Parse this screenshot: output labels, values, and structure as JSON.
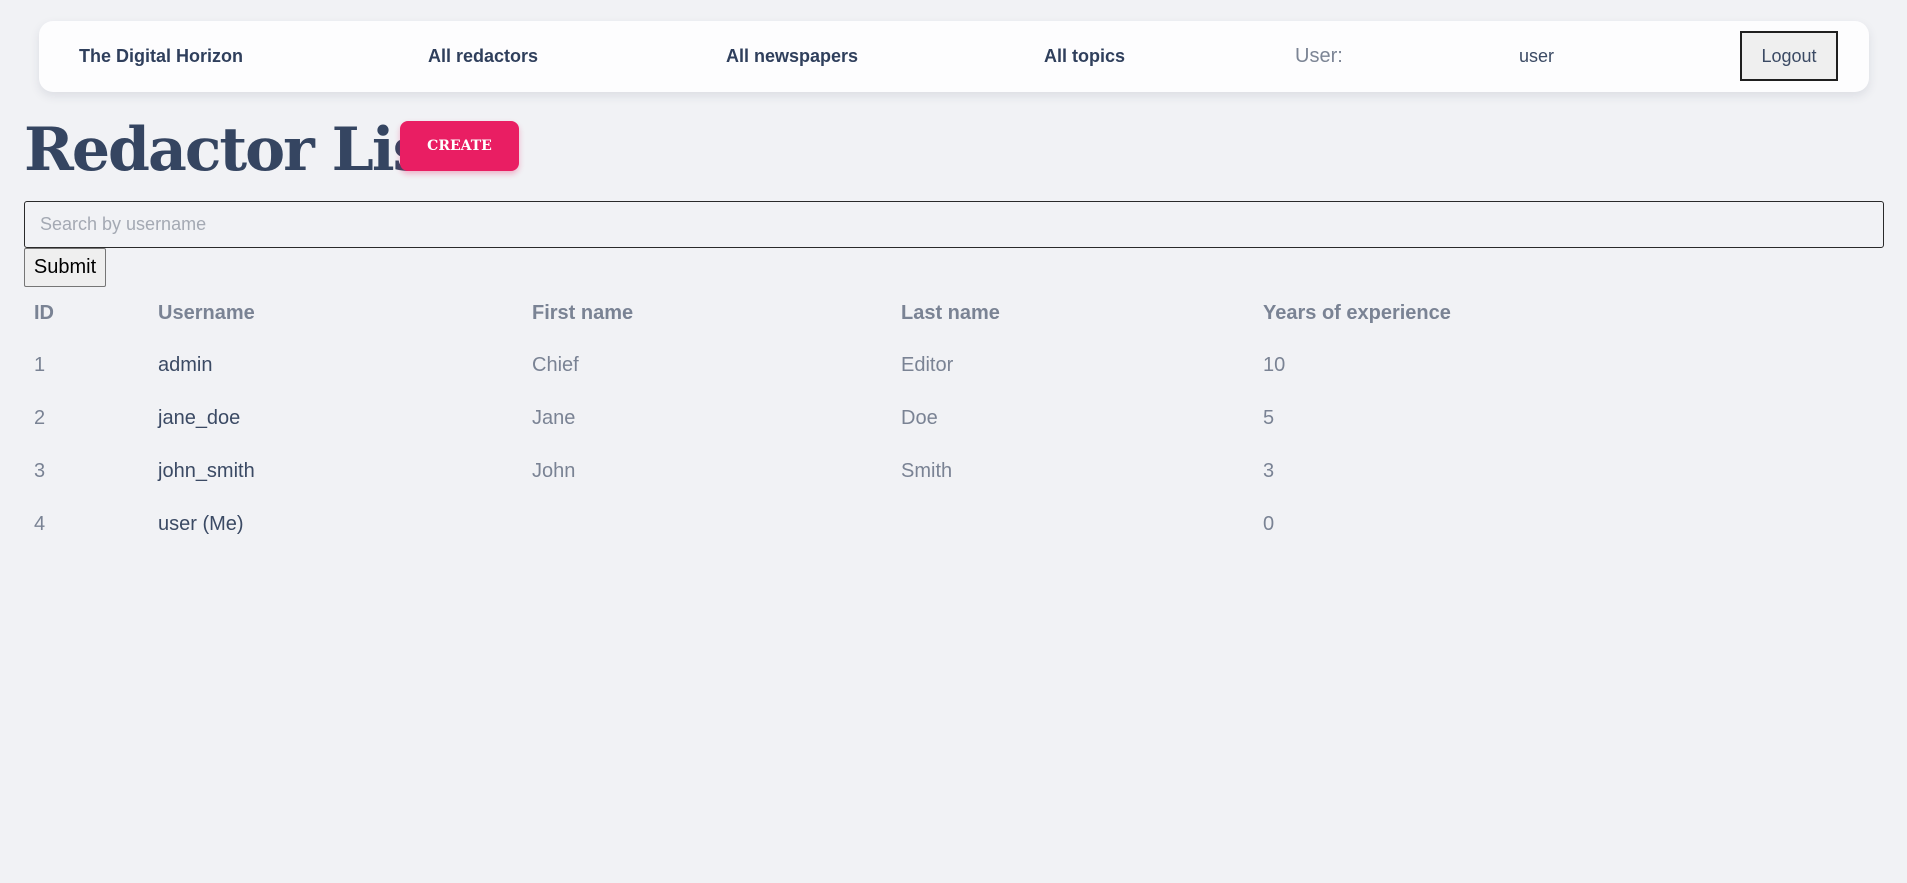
{
  "nav": {
    "brand": "The Digital Horizon",
    "links": {
      "redactors": "All redactors",
      "newspapers": "All newspapers",
      "topics": "All topics"
    },
    "user_label": "User:",
    "user_name": "user",
    "logout_label": "Logout"
  },
  "page": {
    "title": "Redactor List",
    "create_label": "CREATE"
  },
  "search": {
    "placeholder": "Search by username",
    "value": "",
    "submit_label": "Submit"
  },
  "table": {
    "headers": {
      "id": "ID",
      "username": "Username",
      "first_name": "First name",
      "last_name": "Last name",
      "experience": "Years of experience"
    },
    "rows": [
      {
        "id": "1",
        "username": "admin",
        "first_name": "Chief",
        "last_name": "Editor",
        "experience": "10"
      },
      {
        "id": "2",
        "username": "jane_doe",
        "first_name": "Jane",
        "last_name": "Doe",
        "experience": "5"
      },
      {
        "id": "3",
        "username": "john_smith",
        "first_name": "John",
        "last_name": "Smith",
        "experience": "3"
      },
      {
        "id": "4",
        "username": "user (Me)",
        "first_name": "",
        "last_name": "",
        "experience": "0"
      }
    ]
  },
  "colors": {
    "background": "#f1f2f5",
    "navbar": "#fdfdfe",
    "accent": "#e91e63",
    "title": "#354561",
    "muted_text": "#7a8394"
  }
}
